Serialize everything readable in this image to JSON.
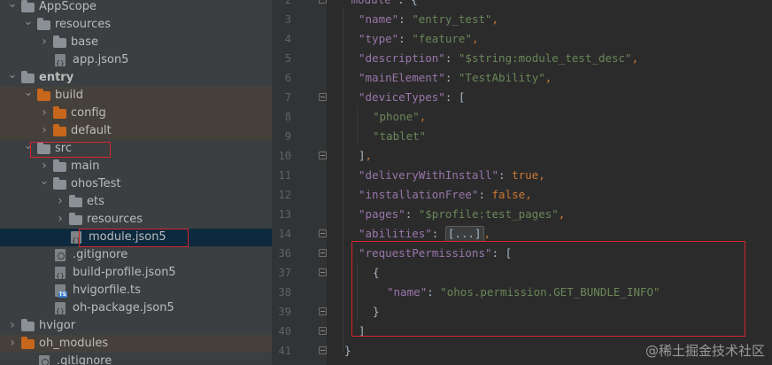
{
  "tree": {
    "items": [
      {
        "label": "AppScope",
        "depth": 0,
        "arrow": "down",
        "icon": "folder",
        "color": "plain",
        "bold": false
      },
      {
        "label": "resources",
        "depth": 1,
        "arrow": "down",
        "icon": "folder",
        "color": "plain",
        "bold": false
      },
      {
        "label": "base",
        "depth": 2,
        "arrow": "right",
        "icon": "folder",
        "color": "plain",
        "bold": false
      },
      {
        "label": "app.json5",
        "depth": 2,
        "arrow": "",
        "icon": "file-json",
        "color": "",
        "bold": false
      },
      {
        "label": "entry",
        "depth": 0,
        "arrow": "down",
        "icon": "folder",
        "color": "plain",
        "bold": true
      },
      {
        "label": "build",
        "depth": 1,
        "arrow": "down",
        "icon": "folder",
        "color": "orange",
        "bold": false,
        "excluded": true
      },
      {
        "label": "config",
        "depth": 2,
        "arrow": "right",
        "icon": "folder",
        "color": "orange",
        "bold": false,
        "excluded": true
      },
      {
        "label": "default",
        "depth": 2,
        "arrow": "right",
        "icon": "folder",
        "color": "orange",
        "bold": false,
        "excluded": true
      },
      {
        "label": "src",
        "depth": 1,
        "arrow": "down",
        "icon": "folder",
        "color": "plain",
        "bold": false
      },
      {
        "label": "main",
        "depth": 2,
        "arrow": "right",
        "icon": "folder",
        "color": "plain",
        "bold": false
      },
      {
        "label": "ohosTest",
        "depth": 2,
        "arrow": "down",
        "icon": "folder",
        "color": "plain",
        "bold": false
      },
      {
        "label": "ets",
        "depth": 3,
        "arrow": "right",
        "icon": "folder",
        "color": "plain",
        "bold": false
      },
      {
        "label": "resources",
        "depth": 3,
        "arrow": "right",
        "icon": "folder",
        "color": "plain",
        "bold": false
      },
      {
        "label": "module.json5",
        "depth": 3,
        "arrow": "",
        "icon": "file-json",
        "color": "",
        "bold": false,
        "selected": true
      },
      {
        "label": ".gitignore",
        "depth": 2,
        "arrow": "",
        "icon": "file-git",
        "color": "",
        "bold": false
      },
      {
        "label": "build-profile.json5",
        "depth": 2,
        "arrow": "",
        "icon": "file-json",
        "color": "",
        "bold": false
      },
      {
        "label": "hvigorfile.ts",
        "depth": 2,
        "arrow": "",
        "icon": "file-ts",
        "color": "",
        "bold": false
      },
      {
        "label": "oh-package.json5",
        "depth": 2,
        "arrow": "",
        "icon": "file-json",
        "color": "",
        "bold": false
      },
      {
        "label": "hvigor",
        "depth": 0,
        "arrow": "right",
        "icon": "folder",
        "color": "plain",
        "bold": false
      },
      {
        "label": "oh_modules",
        "depth": 0,
        "arrow": "right",
        "icon": "folder",
        "color": "orange",
        "bold": false,
        "excluded": true
      },
      {
        "label": ".gitignore",
        "depth": 1,
        "arrow": "",
        "icon": "file-git",
        "color": "",
        "bold": false
      }
    ]
  },
  "editor": {
    "lines": [
      {
        "n": "2",
        "tokens": [
          [
            "k",
            "\"module\""
          ],
          [
            "p",
            ": {"
          ]
        ],
        "indent": 0,
        "fold": true,
        "partial": true
      },
      {
        "n": "3",
        "tokens": [
          [
            "k",
            "\"name\""
          ],
          [
            "p",
            ": "
          ],
          [
            "s",
            "\"entry_test\""
          ],
          [
            "b",
            ","
          ]
        ],
        "indent": 1
      },
      {
        "n": "4",
        "tokens": [
          [
            "k",
            "\"type\""
          ],
          [
            "p",
            ": "
          ],
          [
            "s",
            "\"feature\""
          ],
          [
            "b",
            ","
          ]
        ],
        "indent": 1
      },
      {
        "n": "5",
        "tokens": [
          [
            "k",
            "\"description\""
          ],
          [
            "p",
            ": "
          ],
          [
            "s",
            "\"$string:module_test_desc\""
          ],
          [
            "b",
            ","
          ]
        ],
        "indent": 1
      },
      {
        "n": "6",
        "tokens": [
          [
            "k",
            "\"mainElement\""
          ],
          [
            "p",
            ": "
          ],
          [
            "s",
            "\"TestAbility\""
          ],
          [
            "b",
            ","
          ]
        ],
        "indent": 1
      },
      {
        "n": "7",
        "tokens": [
          [
            "k",
            "\"deviceTypes\""
          ],
          [
            "p",
            ": ["
          ]
        ],
        "indent": 1,
        "fold": true
      },
      {
        "n": "8",
        "tokens": [
          [
            "s",
            "\"phone\""
          ],
          [
            "b",
            ","
          ]
        ],
        "indent": 2
      },
      {
        "n": "9",
        "tokens": [
          [
            "s",
            "\"tablet\""
          ]
        ],
        "indent": 2
      },
      {
        "n": "10",
        "tokens": [
          [
            "p",
            "]"
          ],
          [
            "b",
            ","
          ]
        ],
        "indent": 1,
        "fold": true
      },
      {
        "n": "11",
        "tokens": [
          [
            "k",
            "\"deliveryWithInstall\""
          ],
          [
            "p",
            ": "
          ],
          [
            "b",
            "true"
          ],
          [
            "b",
            ","
          ]
        ],
        "indent": 1
      },
      {
        "n": "12",
        "tokens": [
          [
            "k",
            "\"installationFree\""
          ],
          [
            "p",
            ": "
          ],
          [
            "b",
            "false"
          ],
          [
            "b",
            ","
          ]
        ],
        "indent": 1
      },
      {
        "n": "13",
        "tokens": [
          [
            "k",
            "\"pages\""
          ],
          [
            "p",
            ": "
          ],
          [
            "s",
            "\"$profile:test_pages\""
          ],
          [
            "b",
            ","
          ]
        ],
        "indent": 1
      },
      {
        "n": "14",
        "tokens": [
          [
            "k",
            "\"abilities\""
          ],
          [
            "p",
            ": "
          ],
          [
            "c",
            "[...]"
          ],
          [
            "b",
            ","
          ]
        ],
        "indent": 1,
        "fold": true
      },
      {
        "n": "36",
        "tokens": [
          [
            "k",
            "\"requestPermissions\""
          ],
          [
            "p",
            ": ["
          ]
        ],
        "indent": 1,
        "fold": true
      },
      {
        "n": "37",
        "tokens": [
          [
            "p",
            "{"
          ]
        ],
        "indent": 2,
        "fold": true
      },
      {
        "n": "38",
        "tokens": [
          [
            "k",
            "\"name\""
          ],
          [
            "p",
            ": "
          ],
          [
            "s",
            "\"ohos.permission.GET_BUNDLE_INFO\""
          ]
        ],
        "indent": 3
      },
      {
        "n": "39",
        "tokens": [
          [
            "p",
            "}"
          ]
        ],
        "indent": 2,
        "fold": true
      },
      {
        "n": "40",
        "tokens": [
          [
            "p",
            "]"
          ]
        ],
        "indent": 1,
        "fold": true
      },
      {
        "n": "41",
        "tokens": [
          [
            "p",
            "}"
          ]
        ],
        "indent": 0,
        "fold": true
      }
    ]
  },
  "watermark": "@稀土掘金技术社区",
  "colors": {
    "tree_bg": "#3c3f41",
    "editor_bg": "#2b2b2b",
    "highlight_box": "#d7262c",
    "json_key": "#9876aa",
    "json_string": "#6a8759",
    "keyword": "#cc7832"
  }
}
